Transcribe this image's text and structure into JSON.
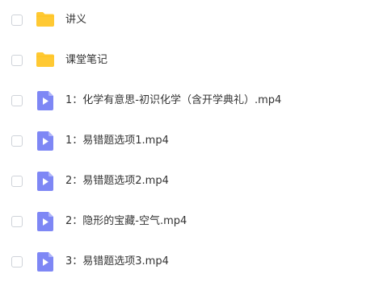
{
  "colors": {
    "folder": "#FFC933",
    "video": "#7E87F5",
    "text": "#333333",
    "checkbox_border": "#CFD3D9"
  },
  "files": [
    {
      "name": "讲义",
      "icon": "folder-icon"
    },
    {
      "name": "课堂笔记",
      "icon": "folder-icon"
    },
    {
      "name": "1：化学有意思-初识化学（含开学典礼）.mp4",
      "icon": "video-file-icon"
    },
    {
      "name": "1：易错题选项1.mp4",
      "icon": "video-file-icon"
    },
    {
      "name": "2：易错题选项2.mp4",
      "icon": "video-file-icon"
    },
    {
      "name": "2：隐形的宝藏-空气.mp4",
      "icon": "video-file-icon"
    },
    {
      "name": "3：易错题选项3.mp4",
      "icon": "video-file-icon"
    }
  ]
}
